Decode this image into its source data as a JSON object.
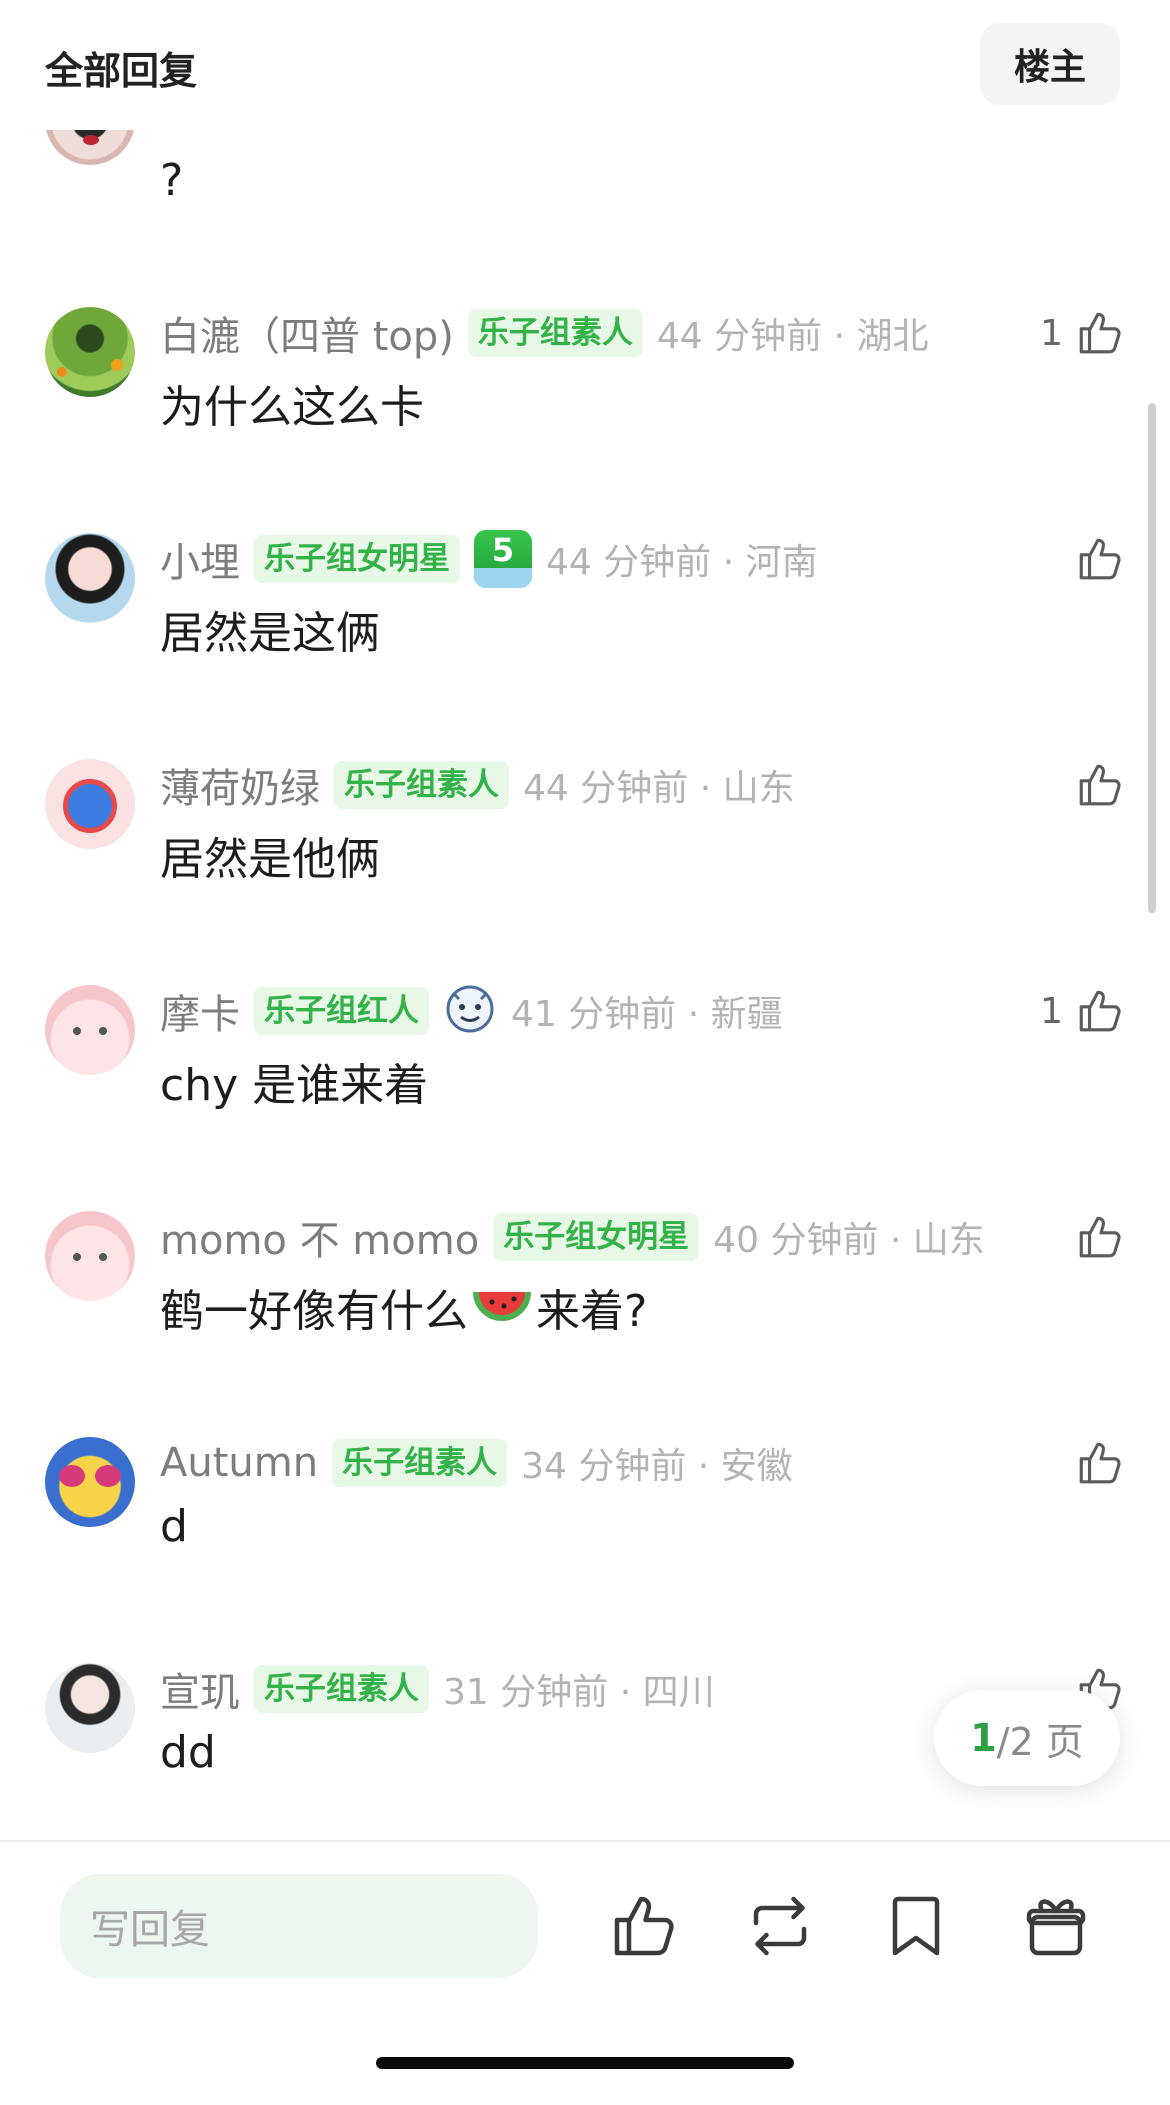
{
  "header": {
    "title": "全部回复",
    "owner_label": "楼主"
  },
  "partial_comment": {
    "content": "?"
  },
  "comments": [
    {
      "name": "白漉（四普 top)",
      "tag": "乐子组素人",
      "time": "44 分钟前 · 湖北",
      "content": "为什么这么卡",
      "likes": "1"
    },
    {
      "name": "小埋",
      "tag": "乐子组女明星",
      "level": "5",
      "time": "44 分钟前 · 河南",
      "content": "居然是这俩",
      "likes": ""
    },
    {
      "name": "薄荷奶绿",
      "tag": "乐子组素人",
      "time": "44 分钟前 · 山东",
      "content": "居然是他俩",
      "likes": ""
    },
    {
      "name": "摩卡",
      "tag": "乐子组红人",
      "time": "41 分钟前 · 新疆",
      "content": "chy 是谁来着",
      "likes": "1"
    },
    {
      "name": "momo 不 momo",
      "tag": "乐子组女明星",
      "time": "40 分钟前 · 山东",
      "content_before": "鹤一好像有什么",
      "content_after": "来着?",
      "likes": ""
    },
    {
      "name": "Autumn",
      "tag": "乐子组素人",
      "time": "34 分钟前 · 安徽",
      "content": "d",
      "likes": ""
    },
    {
      "name": "宣玑",
      "tag": "乐子组素人",
      "time": "31 分钟前 · 四川",
      "content": "dd",
      "likes": ""
    }
  ],
  "pager": {
    "current": "1",
    "rest": "/2 页"
  },
  "bottom": {
    "reply_placeholder": "写回复"
  },
  "icons": {
    "like": "thumbs-up-icon",
    "repost": "repost-icon",
    "bookmark": "bookmark-icon",
    "gift": "gift-icon",
    "watermelon": "watermelon-icon",
    "tiger_badge": "tiger-badge-icon"
  },
  "colors": {
    "accent": "#34b24a",
    "tag_bg": "#e8f8e6",
    "meta_text": "#7d7d7d",
    "time_text": "#b3b3b3"
  }
}
